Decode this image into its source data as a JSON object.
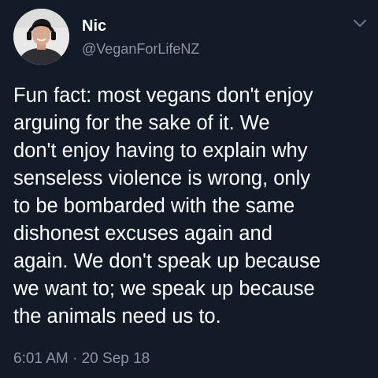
{
  "author": {
    "name": "Nic",
    "handle": "@VeganForLifeNZ",
    "avatar_icon": "profile-photo"
  },
  "tweet": {
    "lines": [
      "Fun fact: most vegans don't enjoy",
      "arguing for the sake of it. We",
      "don't enjoy having to explain why",
      "senseless violence is wrong, only",
      "to be bombarded with the same",
      "dishonest excuses again and",
      "again. We don't speak up because",
      "we want to; we speak up because",
      "the animals need us to."
    ],
    "time": "6:01 AM",
    "separator": "·",
    "date": "20 Sep 18"
  },
  "colors": {
    "background": "#121b27",
    "text": "#ffffff",
    "secondary": "#8a96a3"
  }
}
